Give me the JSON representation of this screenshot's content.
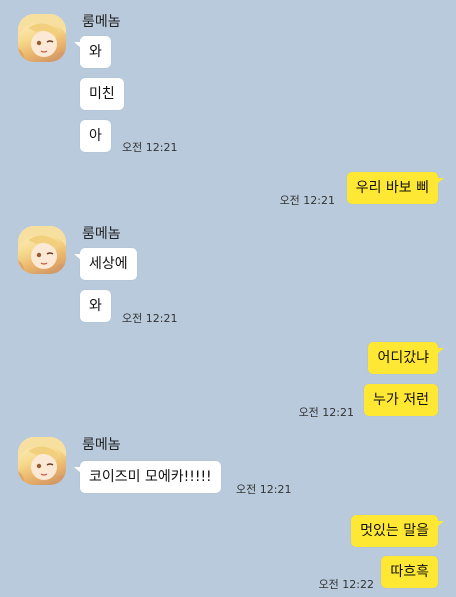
{
  "chat": {
    "groups": [
      {
        "sender": "룸메놈",
        "messages": [
          "와",
          "미친",
          "아"
        ],
        "time": "오전 12:21"
      },
      {
        "mine": true,
        "messages": [
          "우리 바보 삐"
        ],
        "time": "오전 12:21"
      },
      {
        "sender": "룸메놈",
        "messages": [
          "세상에",
          "와"
        ],
        "time": "오전 12:21"
      },
      {
        "mine": true,
        "messages": [
          "어디갔냐",
          "누가 저런"
        ],
        "time": "오전 12:21"
      },
      {
        "sender": "룸메놈",
        "messages": [
          "코이즈미 모에카!!!!!"
        ],
        "time": "오전 12:21"
      },
      {
        "mine": true,
        "messages": [
          "멋있는 말을",
          "따흐흑"
        ],
        "time": "오전 12:22"
      }
    ]
  },
  "icons": {
    "avatar": "profile-avatar-anime-blonde"
  },
  "colors": {
    "background": "#b8cadb",
    "incoming_bubble": "#ffffff",
    "outgoing_bubble": "#ffe833"
  }
}
